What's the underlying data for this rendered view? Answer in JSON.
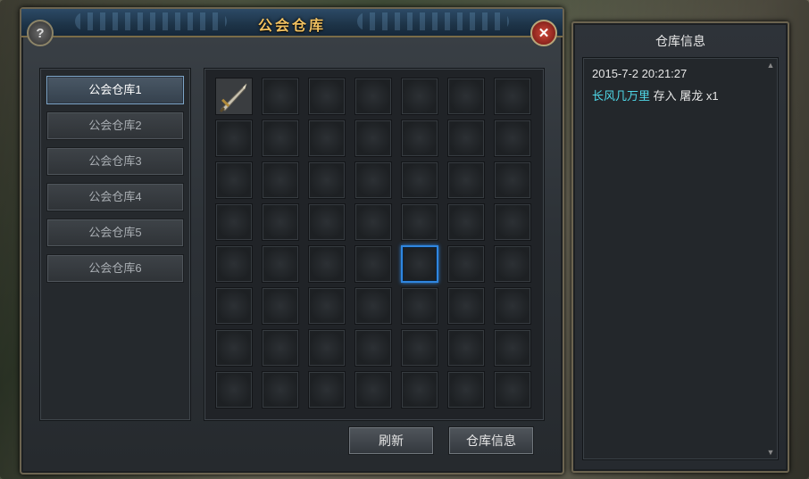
{
  "window": {
    "title": "公会仓库",
    "help_symbol": "?",
    "close_symbol": "✕"
  },
  "tabs": [
    {
      "label": "公会仓库1",
      "active": true
    },
    {
      "label": "公会仓库2",
      "active": false
    },
    {
      "label": "公会仓库3",
      "active": false
    },
    {
      "label": "公会仓库4",
      "active": false
    },
    {
      "label": "公会仓库5",
      "active": false
    },
    {
      "label": "公会仓库6",
      "active": false
    }
  ],
  "grid": {
    "columns": 7,
    "rows": 8,
    "items": [
      {
        "row": 0,
        "col": 0,
        "icon": "sword-icon"
      }
    ],
    "selected": {
      "row": 4,
      "col": 4
    }
  },
  "buttons": {
    "refresh": "刷新",
    "info": "仓库信息"
  },
  "info_panel": {
    "title": "仓库信息",
    "log": {
      "timestamp": "2015-7-2 20:21:27",
      "user": "长风几万里",
      "action": " 存入 屠龙 x1"
    }
  },
  "colors": {
    "accent_gold": "#f0c060",
    "selection_blue": "#2f86e0",
    "username_cyan": "#4fd8e8"
  }
}
